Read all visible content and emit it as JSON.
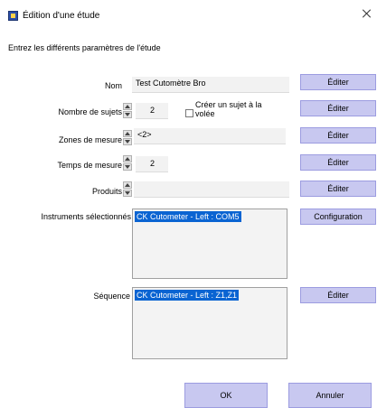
{
  "window": {
    "title": "Édition d'une étude",
    "app_icon": "app-icon"
  },
  "instructions": "Entrez les différents paramètres de l'étude",
  "fields": {
    "nom": {
      "label": "Nom",
      "value": "Test Cutomètre Bro"
    },
    "nombre_sujets": {
      "label": "Nombre de sujets",
      "value": "2"
    },
    "creer_sujet": {
      "label_line1": "Créer un sujet à la",
      "label_line2": "volée",
      "checked": false
    },
    "zones_mesure": {
      "label": "Zones de mesure",
      "value": "<2>"
    },
    "temps_mesure": {
      "label": "Temps de mesure",
      "value": "2"
    },
    "produits": {
      "label": "Produits",
      "value": ""
    },
    "instruments": {
      "label": "Instruments sélectionnés",
      "items": [
        "CK Cutometer - Left : COM5"
      ]
    },
    "sequence": {
      "label": "Séquence",
      "items": [
        "CK Cutometer - Left : Z1,Z1"
      ]
    }
  },
  "buttons": {
    "editer": "Éditer",
    "configuration": "Configuration",
    "ok": "OK",
    "annuler": "Annuler"
  },
  "colors": {
    "button_bg": "#c8c8f0",
    "selection": "#0a64d2"
  }
}
